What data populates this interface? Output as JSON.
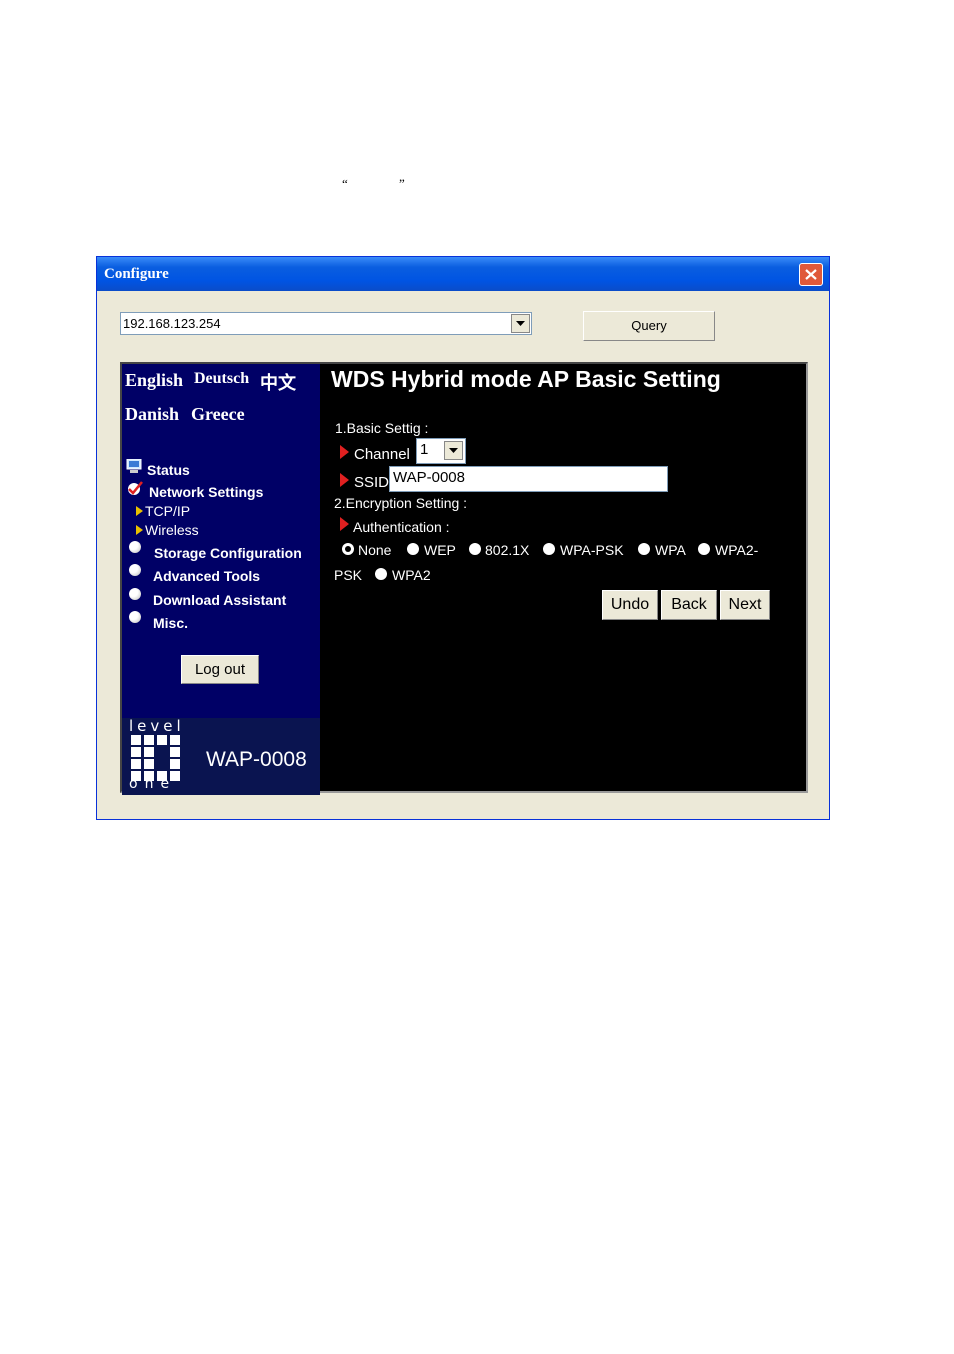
{
  "document": {
    "open_quote": "“",
    "close_quote": "”"
  },
  "window": {
    "title": "Configure"
  },
  "toolbar": {
    "address_value": "192.168.123.254",
    "query_label": "Query"
  },
  "languages": [
    "English",
    "Deutsch",
    "中文",
    "Danish",
    "Greece"
  ],
  "sidebar": {
    "status": "Status",
    "network_settings": "Network Settings",
    "tcpip": "TCP/IP",
    "wireless": "Wireless",
    "storage": "Storage Configuration",
    "advanced": "Advanced Tools",
    "download": "Download Assistant",
    "misc": "Misc.",
    "logout": "Log out",
    "logo_top": "level",
    "logo_bottom": "one",
    "model": "WAP-0008"
  },
  "main": {
    "title": "WDS Hybrid mode AP Basic Setting",
    "section1": "1.Basic Settig :",
    "channel_label": "Channel",
    "channel_value": "1",
    "ssid_label": "SSID",
    "ssid_value": "WAP-0008",
    "section2": "2.Encryption Setting :",
    "auth_label": "Authentication :",
    "options": {
      "none": "None",
      "wep": "WEP",
      "x8021": "802.1X",
      "wpapsk": "WPA-PSK",
      "wpa": "WPA",
      "wpa2psk_a": "WPA2-",
      "wpa2psk_b": "PSK",
      "wpa2": "WPA2"
    },
    "selected_auth": "None",
    "undo": "Undo",
    "back": "Back",
    "next": "Next"
  }
}
